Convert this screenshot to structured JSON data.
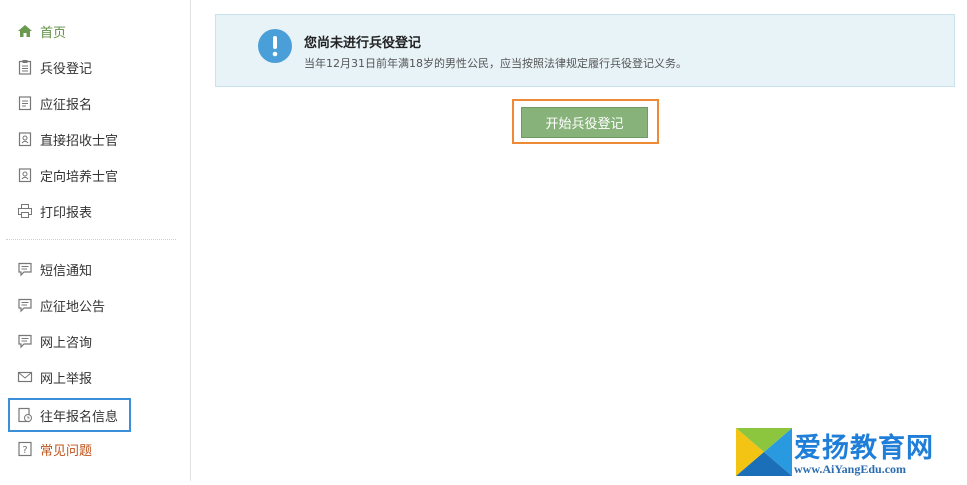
{
  "sidebar": {
    "items": [
      {
        "label": "首页",
        "icon": "home-icon"
      },
      {
        "label": "兵役登记",
        "icon": "clipboard-icon"
      },
      {
        "label": "应征报名",
        "icon": "document-icon"
      },
      {
        "label": "直接招收士官",
        "icon": "id-card-icon"
      },
      {
        "label": "定向培养士官",
        "icon": "id-card-icon"
      },
      {
        "label": "打印报表",
        "icon": "printer-icon"
      },
      {
        "label": "短信通知",
        "icon": "message-icon"
      },
      {
        "label": "应征地公告",
        "icon": "message-icon"
      },
      {
        "label": "网上咨询",
        "icon": "message-icon"
      },
      {
        "label": "网上举报",
        "icon": "mail-icon"
      },
      {
        "label": "往年报名信息",
        "icon": "history-doc-icon"
      },
      {
        "label": "常见问题",
        "icon": "question-icon"
      }
    ]
  },
  "notice": {
    "title": "您尚未进行兵役登记",
    "description": "当年12月31日前年满18岁的男性公民，应当按照法律规定履行兵役登记义务。"
  },
  "main": {
    "start_button_label": "开始兵役登记"
  },
  "watermark": {
    "text": "爱扬教育网",
    "url": "www.AiYangEdu.com"
  },
  "colors": {
    "accent_green": "#87b27a",
    "active_green": "#5f8f43",
    "faq_orange": "#c0541c",
    "highlight_blue": "#3b8fd8",
    "highlight_orange": "#ee8a35",
    "notice_bg": "#e8f3f8"
  }
}
